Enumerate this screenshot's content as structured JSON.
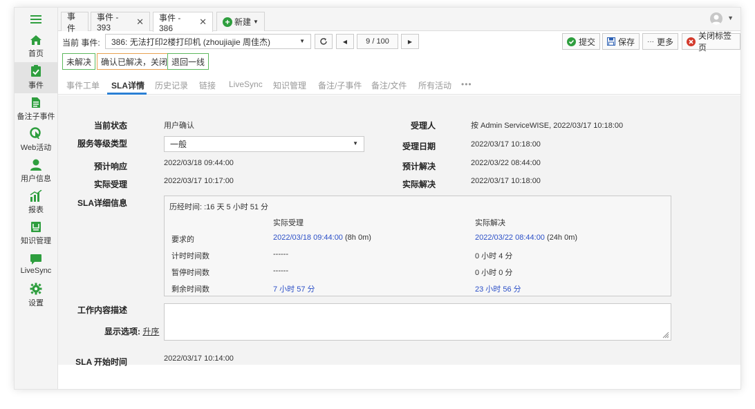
{
  "sidebar": {
    "items": [
      {
        "label": "首页",
        "icon": "home-icon"
      },
      {
        "label": "事件",
        "icon": "incident-icon"
      },
      {
        "label": "备注子事件",
        "icon": "note-icon"
      },
      {
        "label": "Web活动",
        "icon": "web-activity-icon"
      },
      {
        "label": "用户信息",
        "icon": "user-icon"
      },
      {
        "label": "报表",
        "icon": "report-icon"
      },
      {
        "label": "知识管理",
        "icon": "knowledge-icon"
      },
      {
        "label": "LiveSync",
        "icon": "chat-icon"
      },
      {
        "label": "设置",
        "icon": "gear-icon"
      }
    ]
  },
  "tabs": [
    {
      "label": "事件",
      "closable": false
    },
    {
      "label": "事件 - 393",
      "closable": true
    },
    {
      "label": "事件 - 386",
      "closable": true
    },
    {
      "label": "新建",
      "closable": false
    }
  ],
  "toolbar": {
    "current_label": "当前 事件:",
    "current_value": "386: 无法打印2楼打印机 (zhoujiajie 周佳杰)",
    "pager": "9 / 100",
    "submit": "提交",
    "save": "保存",
    "more": "更多",
    "close_tab": "关闭标签页"
  },
  "actions": {
    "unresolved": "未解决",
    "confirm_close": "确认已解决，关闭",
    "return_first_line": "退回一线"
  },
  "subtabs": [
    "事件工单",
    "SLA详情",
    "历史记录",
    "链接",
    "LiveSync",
    "知识管理",
    "备注/子事件",
    "备注/文件",
    "所有活动",
    "•••"
  ],
  "details": {
    "current_status_label": "当前状态",
    "current_status": "用户确认",
    "assignee_label": "受理人",
    "assignee": "按 Admin ServiceWISE, 2022/03/17 10:18:00",
    "service_level_label": "服务等级类型",
    "service_level": "一般",
    "accept_date_label": "受理日期",
    "accept_date": "2022/03/17 10:18:00",
    "expected_response_label": "预计响应",
    "expected_response": "2022/03/18 09:44:00",
    "expected_resolve_label": "预计解决",
    "expected_resolve": "2022/03/22 08:44:00",
    "actual_accept_label": "实际受理",
    "actual_accept": "2022/03/17 10:17:00",
    "actual_resolve_label": "实际解决",
    "actual_resolve": "2022/03/17 10:18:00",
    "sla_detail_label": "SLA详细信息",
    "work_desc_label": "工作内容描述",
    "display_options_label": "显示选项:",
    "display_options_link": "升序",
    "sla_start_label": "SLA 开始时间",
    "sla_start": "2022/03/17 10:14:00"
  },
  "sla": {
    "elapsed": "历经时间: :16 天 5 小时 51 分",
    "col_accept": "实际受理",
    "col_resolve": "实际解决",
    "rows": [
      {
        "label": "要求的",
        "accept_link": "2022/03/18 09:44:00",
        "accept_extra": "(8h 0m)",
        "resolve_link": "2022/03/22 08:44:00",
        "resolve_extra": "(24h 0m)"
      },
      {
        "label": "计时时间数",
        "accept": "------",
        "resolve": "0 小时 4 分"
      },
      {
        "label": "暂停时间数",
        "accept": "------",
        "resolve": "0 小时 0 分"
      },
      {
        "label": "剩余时间数",
        "accept": "7 小时 57 分",
        "resolve": "23 小时 56 分"
      }
    ]
  },
  "colors": {
    "accent": "#2a7fd4",
    "green": "#2e9e3e",
    "link": "#2b4fc7",
    "red": "#d33a2c"
  }
}
